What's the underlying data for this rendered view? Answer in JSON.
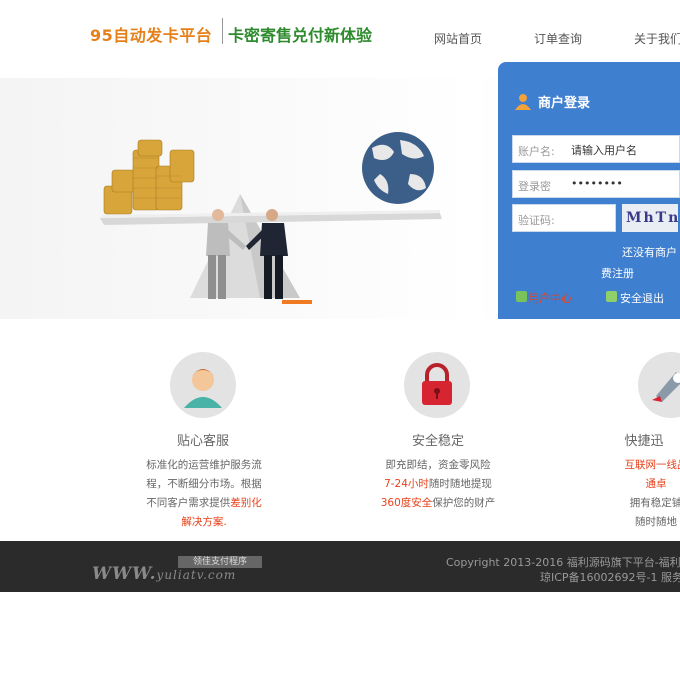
{
  "header": {
    "brand": "95自动发卡平台",
    "slogan": "卡密寄售兑付新体验",
    "nav": [
      "网站首页",
      "订单查询",
      "关于我们"
    ]
  },
  "login": {
    "title": "商户登录",
    "username_label": "账户名:",
    "username_placeholder": "请输入用户名",
    "password_label": "登录密",
    "password_value": "••••••••",
    "captcha_label": "验证码:",
    "captcha_text": "MhTnI",
    "register_prompt": "还没有商户",
    "register_link": "费注册",
    "user_center": "用户中心",
    "logout": "安全退出"
  },
  "features": [
    {
      "title": "贴心客服",
      "lines": [
        {
          "text": "标准化的运营维护服务流",
          "hl": false
        },
        {
          "text": "程，不断细分市场。根据",
          "hl": false
        },
        {
          "text": "不同客户需求提供",
          "hl": false,
          "tail": "差别化"
        },
        {
          "text": "解决方案.",
          "hl": true
        }
      ]
    },
    {
      "title": "安全稳定",
      "lines": [
        {
          "text": "即充即结，资金零风险",
          "hl": false
        },
        {
          "text": "7-24小时",
          "hl": true,
          "tail2": "随时随地提现"
        },
        {
          "text": "360度安全",
          "hl": true,
          "tail2": "保护您的财产"
        }
      ]
    },
    {
      "title": "快捷迅",
      "lines": [
        {
          "text": "互联网一线品",
          "hl": true
        },
        {
          "text": "通卓",
          "hl": true
        },
        {
          "text": "拥有稳定铺",
          "hl": false
        },
        {
          "text": "随时随地",
          "hl": false
        }
      ]
    }
  ],
  "footer": {
    "logo_text": "WWW.",
    "logo_domain": "yuliatv.com",
    "badge": "领佳支付程序",
    "copyright": "Copyright 2013-2016 福利源码旗下平台-福利-",
    "icp": "琼ICP备16002692号-1 服务"
  },
  "colors": {
    "brand": "#e6801a",
    "slogan": "#2e8b2e",
    "login_panel": "#3f7fd0",
    "highlight": "#e8421c",
    "footer_bg": "#2b2b2b"
  }
}
